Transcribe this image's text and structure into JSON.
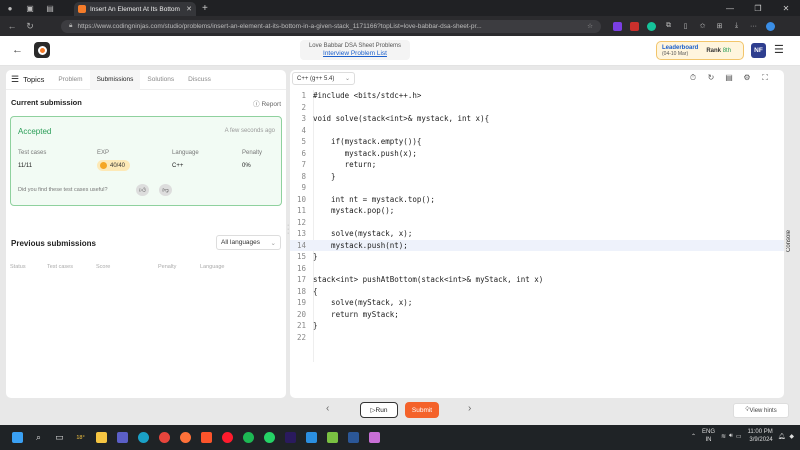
{
  "browser": {
    "tab_title": "Insert An Element At Its Bottom",
    "url": "https://www.codingninjas.com/studio/problems/insert-an-element-at-its-bottom-in-a-given-stack_1171166?topList=love-babbar-dsa-sheet-pr..."
  },
  "header": {
    "sheet_title": "Love Babbar DSA Sheet Problems",
    "sheet_link": "Interview Problem List",
    "leaderboard_label": "Leaderboard",
    "leaderboard_dates": "(04-10 Mar)",
    "rank_label": "Rank",
    "rank_value": "8th",
    "avatar_initials": "NF"
  },
  "left": {
    "tabs": {
      "topics": "Topics",
      "problem": "Problem",
      "submissions": "Submissions",
      "solutions": "Solutions",
      "discuss": "Discuss"
    },
    "current_submission": "Current submission",
    "report": "Report",
    "status": "Accepted",
    "time_ago": "A few seconds ago",
    "labels": {
      "test_cases": "Test cases",
      "exp": "EXP",
      "language": "Language",
      "penalty": "Penalty"
    },
    "values": {
      "test_cases": "11/11",
      "exp": "40/40",
      "language": "C++",
      "penalty": "0%"
    },
    "useful_question": "Did you find these test cases useful?",
    "previous_submissions": "Previous submissions",
    "language_filter": "All languages",
    "columns": {
      "status": "Status",
      "test_cases": "Test cases",
      "score": "Score",
      "penalty": "Penalty",
      "language": "Language"
    }
  },
  "editor": {
    "language": "C++ (g++ 5.4)",
    "lines": [
      {
        "n": "1",
        "code": "#include <bits/stdc++.h>"
      },
      {
        "n": "2",
        "code": ""
      },
      {
        "n": "3",
        "code": "void solve(stack<int>& mystack, int x){"
      },
      {
        "n": "4",
        "code": ""
      },
      {
        "n": "5",
        "code": "    if(mystack.empty()){"
      },
      {
        "n": "6",
        "code": "       mystack.push(x);"
      },
      {
        "n": "7",
        "code": "       return;"
      },
      {
        "n": "8",
        "code": "    }"
      },
      {
        "n": "9",
        "code": ""
      },
      {
        "n": "10",
        "code": "    int nt = mystack.top();"
      },
      {
        "n": "11",
        "code": "    mystack.pop();"
      },
      {
        "n": "12",
        "code": ""
      },
      {
        "n": "13",
        "code": "    solve(mystack, x);"
      },
      {
        "n": "14",
        "code": "    mystack.push(nt);"
      },
      {
        "n": "15",
        "code": "}"
      },
      {
        "n": "16",
        "code": ""
      },
      {
        "n": "17",
        "code": "stack<int> pushAtBottom(stack<int>& myStack, int x)"
      },
      {
        "n": "18",
        "code": "{"
      },
      {
        "n": "19",
        "code": "    solve(myStack, x);"
      },
      {
        "n": "20",
        "code": "    return myStack;"
      },
      {
        "n": "21",
        "code": "}"
      },
      {
        "n": "22",
        "code": ""
      }
    ],
    "run": "Run",
    "submit": "Submit",
    "view_hints": "View hints",
    "console": "Console"
  },
  "taskbar": {
    "weather": "18°",
    "lang_line1": "ENG",
    "lang_line2": "IN",
    "time": "11:00 PM",
    "date": "3/9/2024"
  },
  "colors": {
    "accent": "#f4622a",
    "accepted": "#2a9d57",
    "link": "#1a5fcc"
  }
}
